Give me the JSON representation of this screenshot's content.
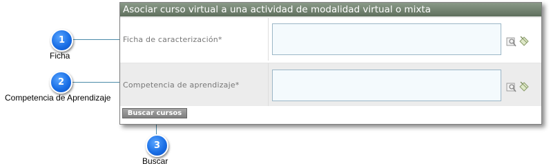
{
  "panel": {
    "title": "Asociar curso virtual a una actividad de modalidad virtual o mixta",
    "rows": [
      {
        "label": "Ficha de caracterización*",
        "value": ""
      },
      {
        "label": "Competencia de aprendizaje*",
        "value": ""
      }
    ],
    "search_button": "Buscar cursos"
  },
  "callouts": [
    {
      "number": "1",
      "label": "Ficha"
    },
    {
      "number": "2",
      "label": "Competencia de Aprendizaje"
    },
    {
      "number": "3",
      "label": "Buscar"
    }
  ],
  "icons": [
    "search-icon",
    "clear-icon"
  ],
  "colors": {
    "title_bar": "#6f7f6d",
    "badge": "#1a6fe6",
    "leader": "#4a8aa8"
  }
}
